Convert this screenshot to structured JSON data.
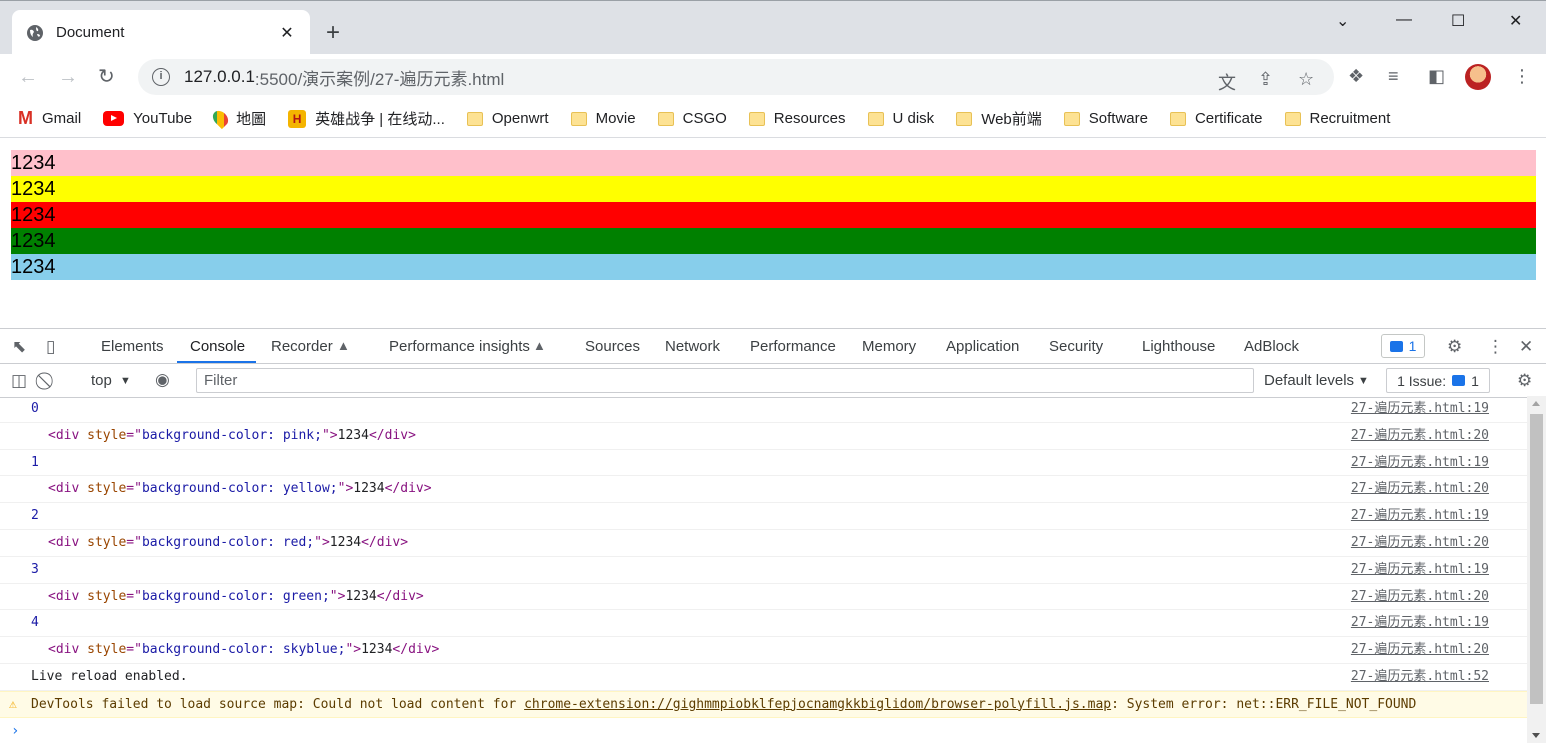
{
  "browser": {
    "tab_title": "Document",
    "tab_close": "✕",
    "new_tab": "+",
    "window_controls": {
      "minimize": "—",
      "maximize": "☐",
      "close": "✕",
      "chevron": "⌄"
    },
    "url_host": "127.0.0.1",
    "url_path": ":5500/演示案例/27-遍历元素.html"
  },
  "bookmarks": [
    {
      "label": "Gmail",
      "icon": "gmail-icon"
    },
    {
      "label": "YouTube",
      "icon": "youtube-icon"
    },
    {
      "label": "地圖",
      "icon": "maps-icon"
    },
    {
      "label": "英雄战争 | 在线动...",
      "icon": "hero-icon"
    },
    {
      "label": "Openwrt",
      "icon": "folder-icon"
    },
    {
      "label": "Movie",
      "icon": "folder-icon"
    },
    {
      "label": "CSGO",
      "icon": "folder-icon"
    },
    {
      "label": "Resources",
      "icon": "folder-icon"
    },
    {
      "label": "U disk",
      "icon": "folder-icon"
    },
    {
      "label": "Web前端",
      "icon": "folder-icon"
    },
    {
      "label": "Software",
      "icon": "folder-icon"
    },
    {
      "label": "Certificate",
      "icon": "folder-icon"
    },
    {
      "label": "Recruitment",
      "icon": "folder-icon"
    }
  ],
  "page": {
    "rows": [
      {
        "text": "1234",
        "color": "#ffc0cb"
      },
      {
        "text": "1234",
        "color": "#ffff00"
      },
      {
        "text": "1234",
        "color": "#ff0000"
      },
      {
        "text": "1234",
        "color": "#008000"
      },
      {
        "text": "1234",
        "color": "#87ceeb"
      }
    ]
  },
  "devtools": {
    "tabs": [
      "Elements",
      "Console",
      "Recorder",
      "Performance insights",
      "Sources",
      "Network",
      "Performance",
      "Memory",
      "Application",
      "Security",
      "Lighthouse",
      "AdBlock"
    ],
    "active_tab": "Console",
    "issues_badge_count": "1",
    "context": "top",
    "filter_placeholder": "Filter",
    "levels": "Default levels",
    "issues_label": "1 Issue:",
    "issues_count": "1",
    "console_lines": [
      {
        "kind": "num",
        "value": "0",
        "source": "27-遍历元素.html:19"
      },
      {
        "kind": "el",
        "color_value": "pink;",
        "text": "1234",
        "source": "27-遍历元素.html:20"
      },
      {
        "kind": "num",
        "value": "1",
        "source": "27-遍历元素.html:19"
      },
      {
        "kind": "el",
        "color_value": "yellow;",
        "text": "1234",
        "source": "27-遍历元素.html:20"
      },
      {
        "kind": "num",
        "value": "2",
        "source": "27-遍历元素.html:19"
      },
      {
        "kind": "el",
        "color_value": "red;",
        "text": "1234",
        "source": "27-遍历元素.html:20"
      },
      {
        "kind": "num",
        "value": "3",
        "source": "27-遍历元素.html:19"
      },
      {
        "kind": "el",
        "color_value": "green;",
        "text": "1234",
        "source": "27-遍历元素.html:20"
      },
      {
        "kind": "num",
        "value": "4",
        "source": "27-遍历元素.html:19"
      },
      {
        "kind": "el",
        "color_value": "skyblue;",
        "text": "1234",
        "source": "27-遍历元素.html:20"
      },
      {
        "kind": "log",
        "value": "Live reload enabled.",
        "source": "27-遍历元素.html:52"
      }
    ],
    "warning": {
      "prefix": "DevTools failed to load source map: Could not load content for ",
      "link": "chrome-extension://gighmmpiobklfepjocnamgkkbiglidom/browser-polyfill.js.map",
      "suffix": ": System error: net::ERR_FILE_NOT_FOUND"
    },
    "prompt": "›"
  }
}
